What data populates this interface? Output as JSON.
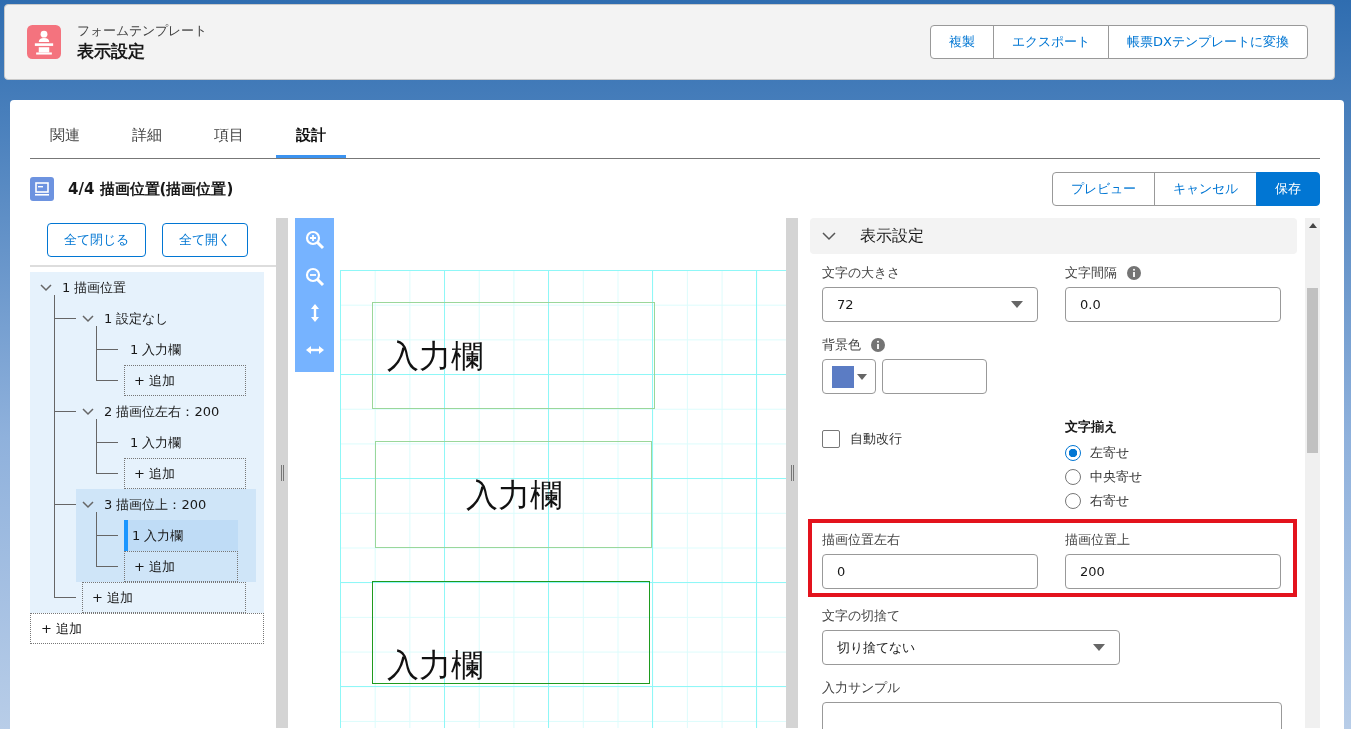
{
  "header": {
    "subtitle": "フォームテンプレート",
    "title": "表示設定",
    "actions": [
      "複製",
      "エクスポート",
      "帳票DXテンプレートに変換"
    ]
  },
  "tabs": [
    {
      "label": "関連",
      "selected": false
    },
    {
      "label": "詳細",
      "selected": false
    },
    {
      "label": "項目",
      "selected": false
    },
    {
      "label": "設計",
      "selected": true
    }
  ],
  "section": {
    "title": "4/4 描画位置(描画位置)",
    "actions": [
      {
        "label": "プレビュー",
        "kind": "neutral"
      },
      {
        "label": "キャンセル",
        "kind": "neutral"
      },
      {
        "label": "保存",
        "kind": "brand"
      }
    ]
  },
  "tree": {
    "buttons": [
      "全て閉じる",
      "全て開く"
    ],
    "items": [
      {
        "kind": "node",
        "label": "1 描画位置",
        "expanded": true,
        "selected": false,
        "children": [
          {
            "kind": "node",
            "label": "1 設定なし",
            "expanded": true,
            "selected": false,
            "children": [
              {
                "kind": "node",
                "label": "1 入力欄",
                "selected": false
              },
              {
                "kind": "add",
                "label": "+ 追加"
              }
            ]
          },
          {
            "kind": "node",
            "label": "2 描画位左右：200",
            "expanded": true,
            "selected": false,
            "children": [
              {
                "kind": "node",
                "label": "1 入力欄",
                "selected": false
              },
              {
                "kind": "add",
                "label": "+ 追加"
              }
            ]
          },
          {
            "kind": "node",
            "label": "3 描画位上：200",
            "expanded": true,
            "selected": true,
            "children": [
              {
                "kind": "node",
                "label": "1 入力欄",
                "selected": true
              },
              {
                "kind": "add",
                "label": "+ 追加"
              }
            ]
          },
          {
            "kind": "add",
            "label": "+ 追加"
          }
        ]
      },
      {
        "kind": "add",
        "label": "+ 追加"
      }
    ]
  },
  "canvas": {
    "fields": [
      {
        "label": "入力欄",
        "selected": false
      },
      {
        "label": "入力欄",
        "selected": false
      },
      {
        "label": "入力欄",
        "selected": true
      }
    ]
  },
  "properties": {
    "section": {
      "title": "表示設定",
      "expanded": true
    },
    "font_size": {
      "label": "文字の大きさ",
      "value": "72"
    },
    "letter_spacing": {
      "label": "文字間隔",
      "value": "0.0"
    },
    "background": {
      "label": "背景色",
      "color": "#5b7cc4"
    },
    "auto_wrap": {
      "label": "自動改行",
      "checked": false
    },
    "alignment": {
      "label": "文字揃え",
      "options": [
        {
          "label": "左寄せ",
          "selected": true
        },
        {
          "label": "中央寄せ",
          "selected": false
        },
        {
          "label": "右寄せ",
          "selected": false
        }
      ]
    },
    "position": {
      "highlighted": true,
      "fields": [
        {
          "label": "描画位置左右",
          "value": "0"
        },
        {
          "label": "描画位置上",
          "value": "200"
        }
      ]
    },
    "truncate": {
      "label": "文字の切捨て",
      "value": "切り捨てない"
    },
    "sample": {
      "label": "入力サンプル"
    }
  }
}
